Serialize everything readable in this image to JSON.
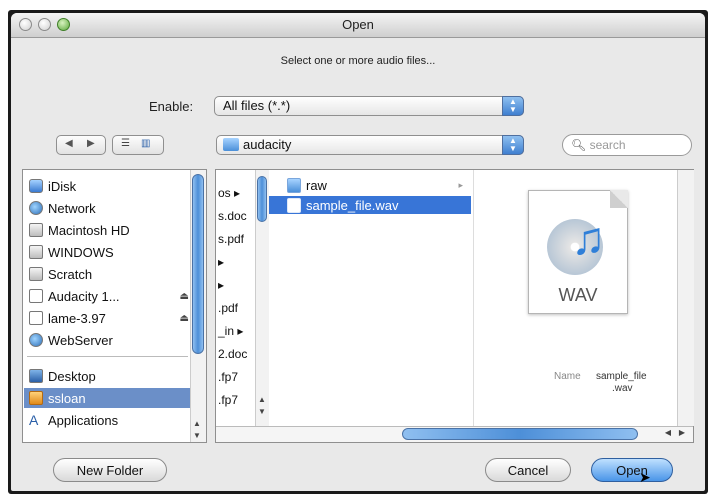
{
  "window": {
    "title": "Open"
  },
  "prompt": "Select one or more audio files...",
  "enable": {
    "label": "Enable:",
    "value": "All files (*.*)"
  },
  "location": {
    "value": "audacity"
  },
  "search": {
    "placeholder": "search"
  },
  "sidebar": {
    "devices": [
      {
        "label": "iDisk",
        "icon": "idisk-icon"
      },
      {
        "label": "Network",
        "icon": "globe-icon"
      },
      {
        "label": "Macintosh HD",
        "icon": "drive-icon"
      },
      {
        "label": "WINDOWS",
        "icon": "drive-icon"
      },
      {
        "label": "Scratch",
        "icon": "drive-icon"
      },
      {
        "label": "Audacity 1...",
        "icon": "document-icon",
        "eject": "⏏"
      },
      {
        "label": "lame-3.97",
        "icon": "document-icon",
        "eject": "⏏"
      },
      {
        "label": "WebServer",
        "icon": "globe-icon"
      }
    ],
    "places": [
      {
        "label": "Desktop",
        "icon": "desktop-icon"
      },
      {
        "label": "ssloan",
        "icon": "home-icon"
      },
      {
        "label": "Applications",
        "icon": "applications-icon"
      }
    ]
  },
  "column1": {
    "items": [
      "os ▸",
      "s.doc",
      "s.pdf",
      "▸",
      "▸",
      ".pdf",
      "_in ▸",
      "2.doc",
      ".fp7",
      ".fp7"
    ]
  },
  "column2": {
    "items": [
      {
        "label": "raw",
        "icon": "folder-icon",
        "arrow": "▸",
        "selected": false
      },
      {
        "label": "sample_file.wav",
        "icon": "audio-file-icon",
        "arrow": "",
        "selected": true
      }
    ]
  },
  "preview": {
    "type_label": "WAV",
    "name_label": "Name",
    "name_value_1": "sample_file",
    "name_value_2": ".wav"
  },
  "buttons": {
    "new_folder": "New Folder",
    "cancel": "Cancel",
    "open": "Open"
  },
  "colors": {
    "selection": "#3875d7",
    "accent": "#4a95e8"
  }
}
